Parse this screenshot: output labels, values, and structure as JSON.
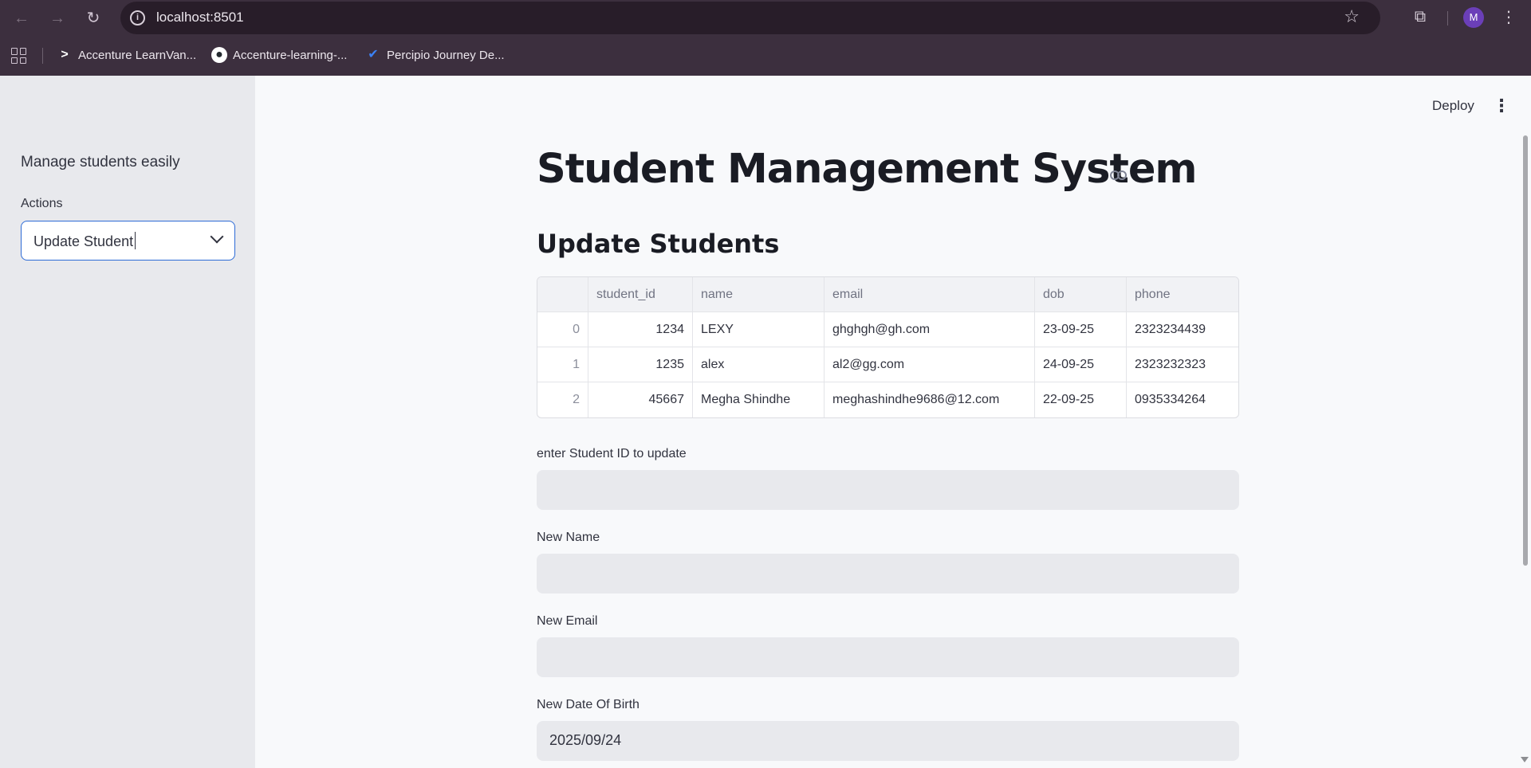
{
  "browser": {
    "url": "localhost:8501",
    "profile_initial": "M",
    "icons": [
      "back-icon",
      "forward-icon",
      "reload-icon",
      "info-icon",
      "star-icon",
      "extensions-icon",
      "more-vert-icon",
      "apps-grid-icon"
    ],
    "bookmarks": [
      {
        "label": "Accenture LearnVan...",
        "icon": "accenture-icon"
      },
      {
        "label": "Accenture-learning-...",
        "icon": "github-icon"
      },
      {
        "label": "Percipio Journey De...",
        "icon": "percipio-icon"
      }
    ]
  },
  "sidebar": {
    "caption": "Manage students easily",
    "actions_label": "Actions",
    "actions_value": "Update Student"
  },
  "header": {
    "deploy_label": "Deploy"
  },
  "main": {
    "title": "Student Management System",
    "subtitle": "Update Students",
    "table": {
      "columns": [
        "",
        "student_id",
        "name",
        "email",
        "dob",
        "phone"
      ],
      "rows": [
        {
          "index": "0",
          "student_id": "1234",
          "name": "LEXY",
          "email": "ghghgh@gh.com",
          "dob": "23-09-25",
          "phone": "2323234439"
        },
        {
          "index": "1",
          "student_id": "1235",
          "name": "alex",
          "email": "al2@gg.com",
          "dob": "24-09-25",
          "phone": "2323232323"
        },
        {
          "index": "2",
          "student_id": "45667",
          "name": "Megha Shindhe",
          "email": "meghashindhe9686@12.com",
          "dob": "22-09-25",
          "phone": "0935334264"
        }
      ]
    },
    "fields": {
      "student_id_label": "enter Student ID to update",
      "student_id_value": "",
      "name_label": "New Name",
      "name_value": "",
      "email_label": "New Email",
      "email_value": "",
      "dob_label": "New Date Of Birth",
      "dob_value": "2025/09/24"
    }
  },
  "colors": {
    "browser_frame": "#3c2f3e",
    "sidebar_bg": "#e8e9ed",
    "page_bg": "#f8f9fb",
    "select_border": "#2d6bd6",
    "avatar": "#6b3fb8"
  }
}
